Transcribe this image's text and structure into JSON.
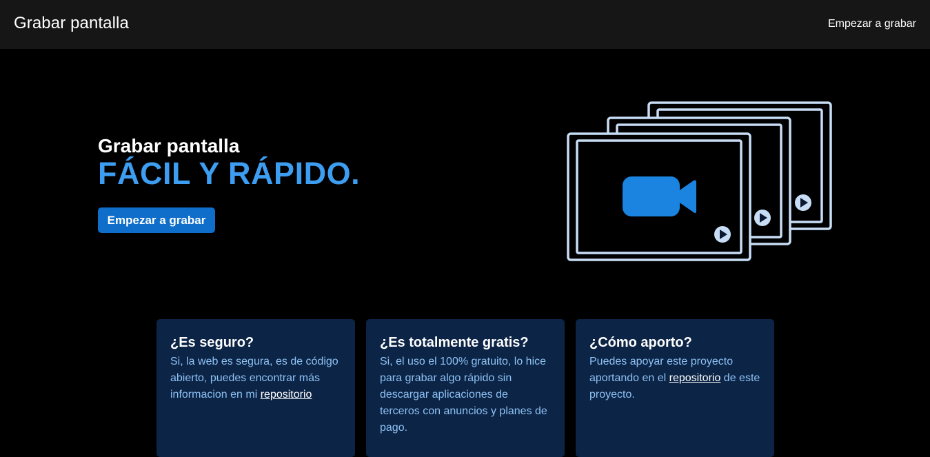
{
  "navbar": {
    "brand": "Grabar pantalla",
    "link": "Empezar a grabar"
  },
  "hero": {
    "subtitle": "Grabar pantalla",
    "title": "FÁCIL Y RÁPIDO.",
    "button": "Empezar a grabar"
  },
  "colors": {
    "accent": "#3d9df0",
    "button": "#0f6ec9",
    "card_bg": "#0c2446",
    "card_text": "#8ec2f4",
    "frame_stroke": "#c7ddf6",
    "camera": "#1a84e0"
  },
  "icons": [
    "video-camera-icon",
    "play-icon"
  ],
  "cards": [
    {
      "title": "¿Es seguro?",
      "text_before": "Si, la web es segura, es de código abierto, puedes encontrar más informacion en mi ",
      "link": "repositorio",
      "text_after": ""
    },
    {
      "title": "¿Es totalmente gratis?",
      "text_before": "Si, el uso el 100% gratuito, lo hice para grabar algo rápido sin descargar aplicaciones de terceros con anuncios y planes de pago.",
      "link": "",
      "text_after": ""
    },
    {
      "title": "¿Cómo aporto?",
      "text_before": "Puedes apoyar este proyecto aportando en el ",
      "link": "repositorio",
      "text_after": " de este proyecto."
    }
  ]
}
